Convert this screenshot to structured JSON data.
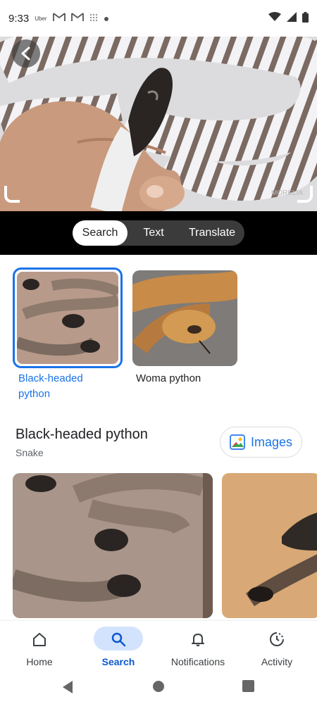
{
  "status_bar": {
    "time": "9:33",
    "notification_app": "Uber",
    "icons": [
      "gmail-icon",
      "gmail-icon",
      "grid-icon",
      "dot-icon",
      "wifi-icon",
      "signal-icon",
      "battery-icon"
    ]
  },
  "hero": {
    "back_icon": "chevron-left-icon",
    "watermark": "MORELIA"
  },
  "modes": {
    "items": [
      "Search",
      "Text",
      "Translate"
    ],
    "selected": "Search"
  },
  "results": [
    {
      "label": "Black-headed python",
      "selected": true
    },
    {
      "label": "Woma python",
      "selected": false
    }
  ],
  "knowledge": {
    "title": "Black-headed python",
    "subtitle": "Snake",
    "images_button": "Images"
  },
  "bottom_nav": {
    "items": [
      {
        "label": "Home",
        "icon": "home-icon"
      },
      {
        "label": "Search",
        "icon": "search-icon"
      },
      {
        "label": "Notifications",
        "icon": "bell-icon"
      },
      {
        "label": "Activity",
        "icon": "activity-icon"
      }
    ],
    "selected": "Search"
  },
  "system_nav": {
    "buttons": [
      "back-triangle-icon",
      "home-circle-icon",
      "recents-square-icon"
    ]
  },
  "colors": {
    "accent": "#1a73e8",
    "nav_selected_bg": "#d3e3fd",
    "nav_selected_text": "#0b57d0",
    "mode_bar_bg": "#000000"
  }
}
